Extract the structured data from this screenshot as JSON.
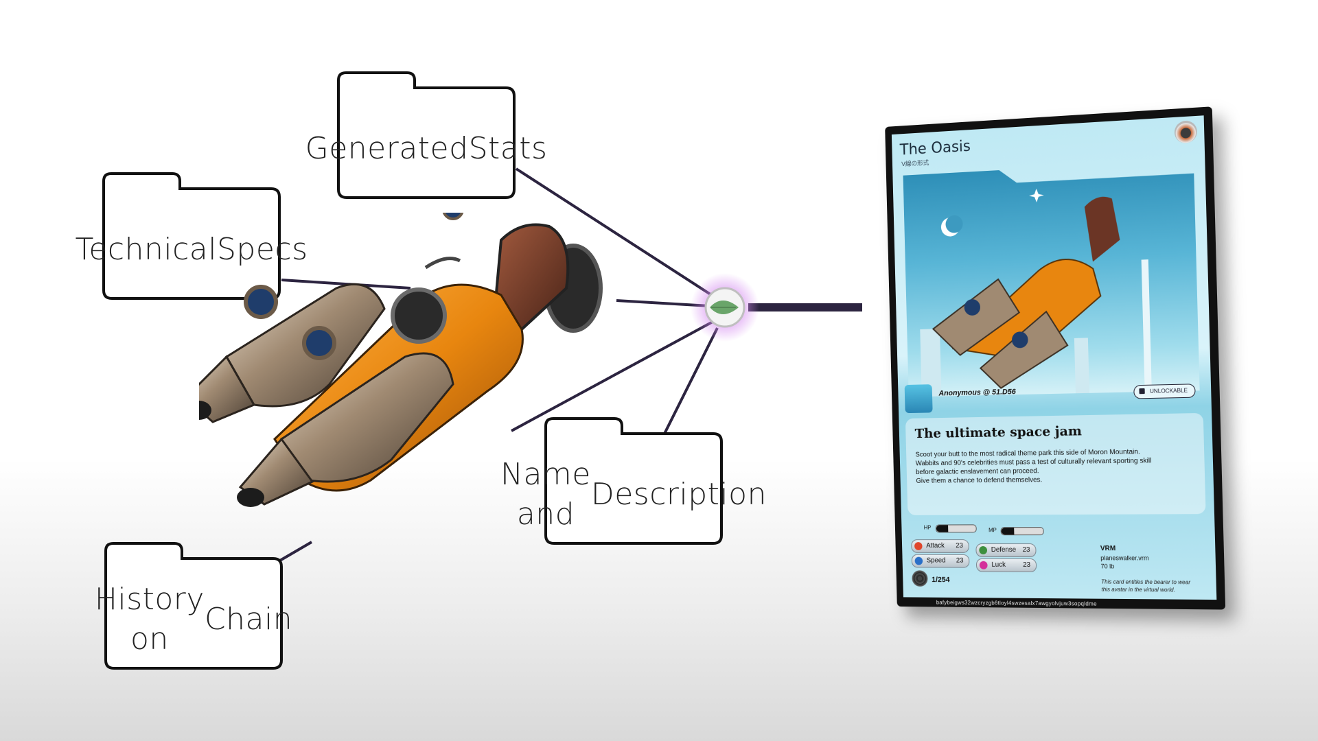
{
  "folders": {
    "technical_specs": [
      "Technical",
      "Specs"
    ],
    "generated_stats": [
      "Generated",
      "Stats"
    ],
    "name_description": [
      "Name and",
      "Description"
    ],
    "history_chain": [
      "History on",
      "Chain"
    ]
  },
  "colors": {
    "line": "#2c2440",
    "node_glow": "#d58cf0",
    "leaf": "#6aa56a",
    "vehicle_orange": "#e8860f"
  },
  "card": {
    "title": "The Oasis",
    "subtitle": "V線の形式",
    "owner": "Anonymous @ 51.D56",
    "badge": "UNLOCKABLE",
    "description_title": "The ultimate space jam",
    "description_lines": [
      "Scoot your butt to the most radical theme park this side of Moron Mountain.",
      "Wabbits and 90's celebrities must pass a test of culturally relevant sporting skill",
      "before galactic enslavement can proceed.",
      "Give them a chance to defend themselves."
    ],
    "hp_label": "HP",
    "mp_label": "MP",
    "hp_level": 0.3,
    "mp_level": 0.3,
    "stats": [
      {
        "name": "Attack",
        "value": "23",
        "color": "#e0452b"
      },
      {
        "name": "Defense",
        "value": "23",
        "color": "#3e8f3e"
      },
      {
        "name": "Speed",
        "value": "23",
        "color": "#2a70c8"
      },
      {
        "name": "Luck",
        "value": "23",
        "color": "#d42f9a"
      }
    ],
    "edition": "1/254",
    "vrm_title": "VRM",
    "vrm_file": "planeswalker.vrm",
    "vrm_size": "70 lb",
    "vrm_note": "This card entitles the bearer to wear this avatar in the virtual world.",
    "hash": "bafybeigws32wzcryzgb6tloyl4swzesalx7awgyolvjuw3sopqldme"
  }
}
